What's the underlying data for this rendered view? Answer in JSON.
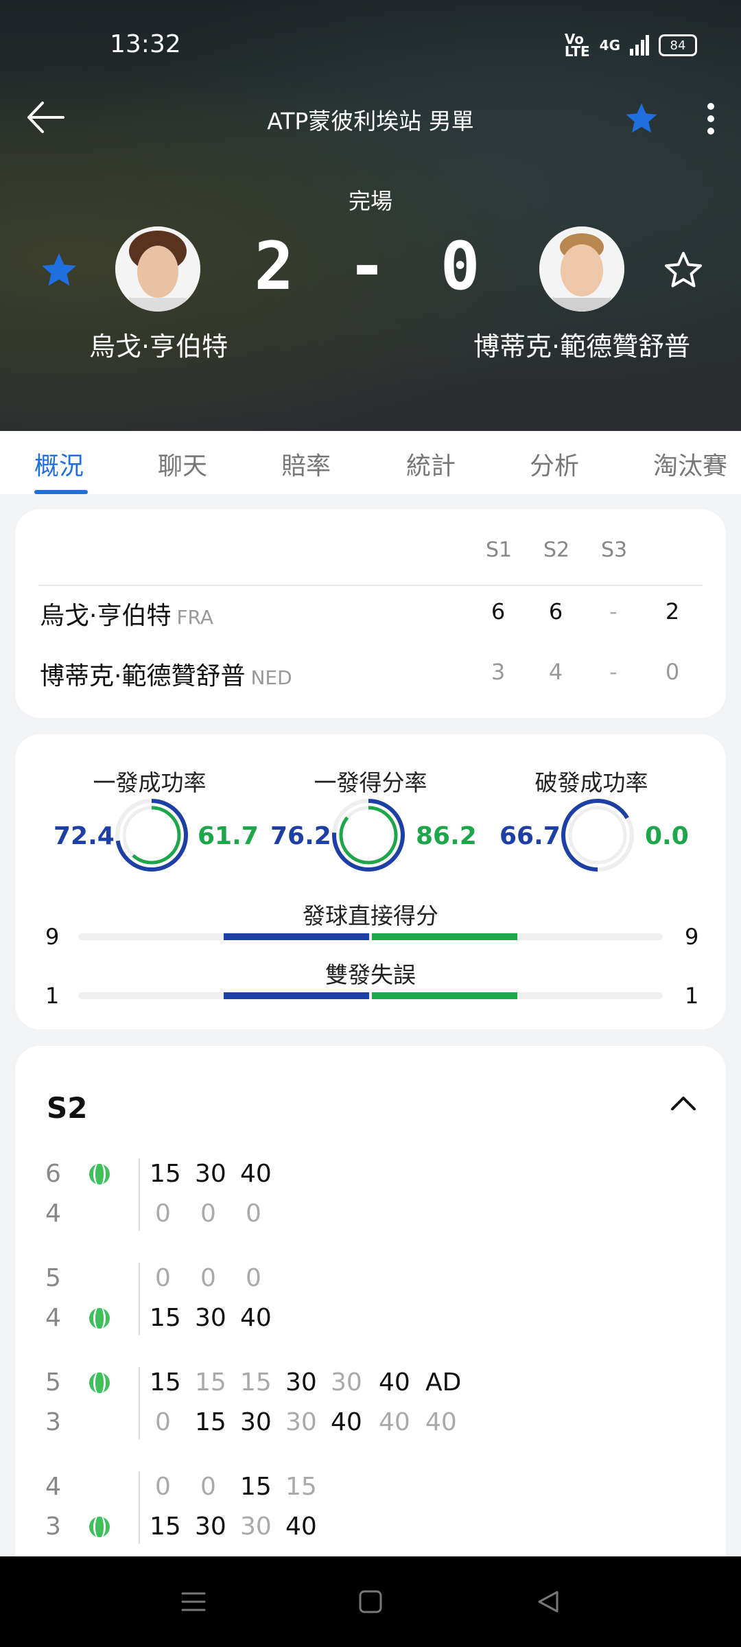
{
  "status_bar": {
    "time": "13:32",
    "signal": "4G",
    "battery": "84"
  },
  "header": {
    "title": "ATP蒙彼利埃站 男單"
  },
  "match": {
    "status": "完場",
    "score": "2 - 0",
    "player1": {
      "name": "烏戈·亨伯特",
      "favorited": true
    },
    "player2": {
      "name": "博蒂克·範德贊舒普",
      "favorited": false
    }
  },
  "tabs": [
    "概況",
    "聊天",
    "賠率",
    "統計",
    "分析",
    "淘汰賽"
  ],
  "scoreboard": {
    "headers": [
      "S1",
      "S2",
      "S3"
    ],
    "rows": [
      {
        "name": "烏戈·亨伯特",
        "country": "FRA",
        "sets": [
          "6",
          "6",
          "-"
        ],
        "points": "2"
      },
      {
        "name": "博蒂克·範德贊舒普",
        "country": "NED",
        "sets": [
          "3",
          "4",
          "-"
        ],
        "points": "0"
      }
    ]
  },
  "stats": {
    "rings": [
      {
        "label": "一發成功率",
        "left": "72.4",
        "right": "61.7"
      },
      {
        "label": "一發得分率",
        "left": "76.2",
        "right": "86.2"
      },
      {
        "label": "破發成功率",
        "left": "66.7",
        "right": "0.0"
      }
    ],
    "bars": [
      {
        "label": "發球直接得分",
        "left": "9",
        "right": "9"
      },
      {
        "label": "雙發失誤",
        "left": "1",
        "right": "1"
      }
    ]
  },
  "set_detail": {
    "title": "S2",
    "games": [
      {
        "top": "6",
        "bottom": "4",
        "server": "top",
        "top_pts": [
          "15",
          "30",
          "40"
        ],
        "bottom_pts": [
          "0",
          "0",
          "0"
        ]
      },
      {
        "top": "5",
        "bottom": "4",
        "server": "bottom",
        "top_pts": [
          "0",
          "0",
          "0"
        ],
        "bottom_pts": [
          "15",
          "30",
          "40"
        ]
      },
      {
        "top": "5",
        "bottom": "3",
        "server": "top",
        "top_pts": [
          "15",
          "15",
          "15",
          "30",
          "30",
          "40",
          "AD"
        ],
        "bottom_pts": [
          "0",
          "15",
          "30",
          "30",
          "40",
          "40",
          "40"
        ]
      },
      {
        "top": "4",
        "bottom": "3",
        "server": "bottom",
        "top_pts": [
          "0",
          "0",
          "15",
          "15"
        ],
        "bottom_pts": [
          "15",
          "30",
          "30",
          "40"
        ]
      }
    ]
  },
  "colors": {
    "accent": "#1f6fe0",
    "home": "#1d3fa6",
    "away": "#1ea64a"
  }
}
